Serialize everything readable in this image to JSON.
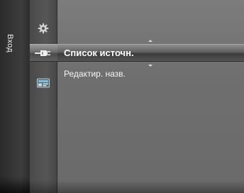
{
  "menu": {
    "title": "Вход",
    "icons": [
      {
        "name": "settings",
        "icon": "gear-icon"
      },
      {
        "name": "input",
        "icon": "plug-icon",
        "selected": true
      },
      {
        "name": "application",
        "icon": "media-icon"
      }
    ],
    "items": [
      {
        "label": "Список источн.",
        "selected": true
      },
      {
        "label": "Редактир. назв.",
        "selected": false
      }
    ]
  },
  "colors": {
    "background": "#6f6f6f",
    "tab_strip": "#333333",
    "highlight": "#4a4a4a",
    "text": "#ffffff"
  }
}
